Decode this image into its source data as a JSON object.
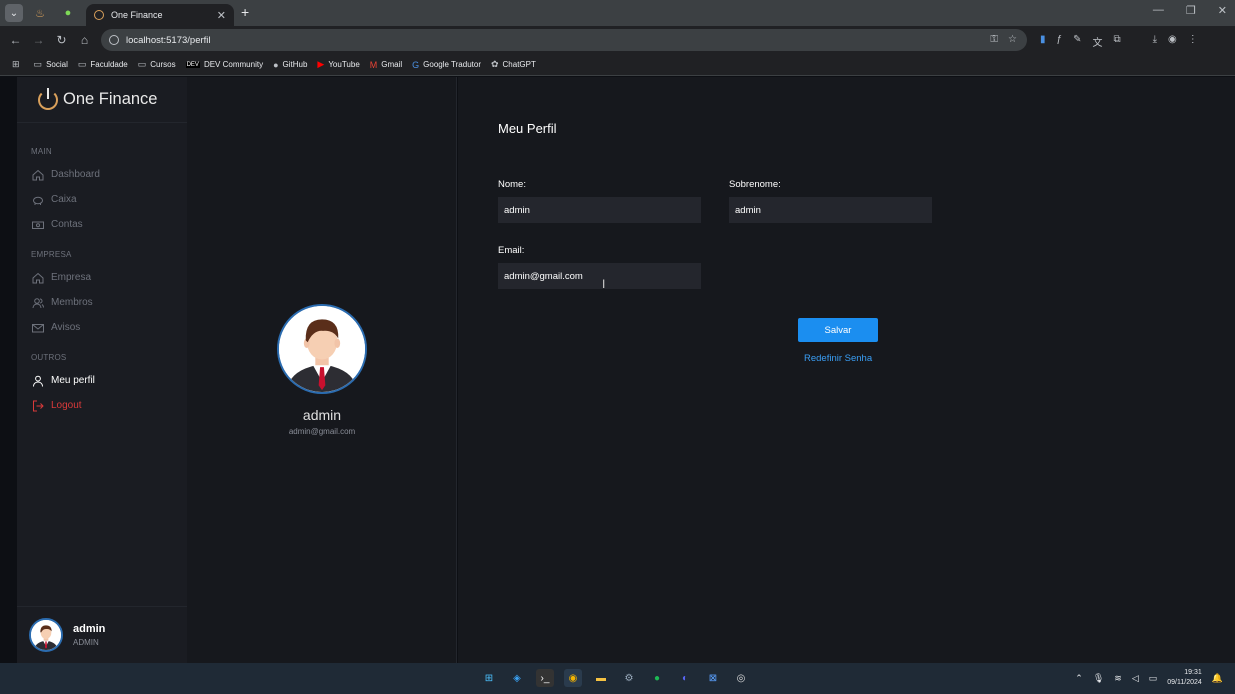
{
  "browser": {
    "tab_title": "One Finance",
    "url": "localhost:5173/perfil",
    "bookmarks": [
      "Social",
      "Faculdade",
      "Cursos",
      "DEV Community",
      "GitHub",
      "YouTube",
      "Gmail",
      "Google Tradutor",
      "ChatGPT"
    ]
  },
  "sidebar": {
    "brand": "One Finance",
    "sections": {
      "main": "MAIN",
      "empresa": "EMPRESA",
      "outros": "OUTROS"
    },
    "items": {
      "dashboard": "Dashboard",
      "caixa": "Caixa",
      "contas": "Contas",
      "empresa": "Empresa",
      "membros": "Membros",
      "avisos": "Avisos",
      "meu_perfil": "Meu perfil",
      "logout": "Logout"
    },
    "user": {
      "name": "admin",
      "role": "ADMIN"
    }
  },
  "profile": {
    "name": "admin",
    "email": "admin@gmail.com"
  },
  "form": {
    "title": "Meu Perfil",
    "nome_label": "Nome:",
    "nome_value": "admin",
    "sobrenome_label": "Sobrenome:",
    "sobrenome_value": "admin",
    "email_label": "Email:",
    "email_value": "admin@gmail.com",
    "save_label": "Salvar",
    "reset_label": "Redefinir Senha"
  },
  "taskbar": {
    "time": "19:31",
    "date": "09/11/2024"
  },
  "colors": {
    "accent": "#1b8ef0",
    "danger": "#d93a3a",
    "brand_logo": "#d9a05b"
  }
}
